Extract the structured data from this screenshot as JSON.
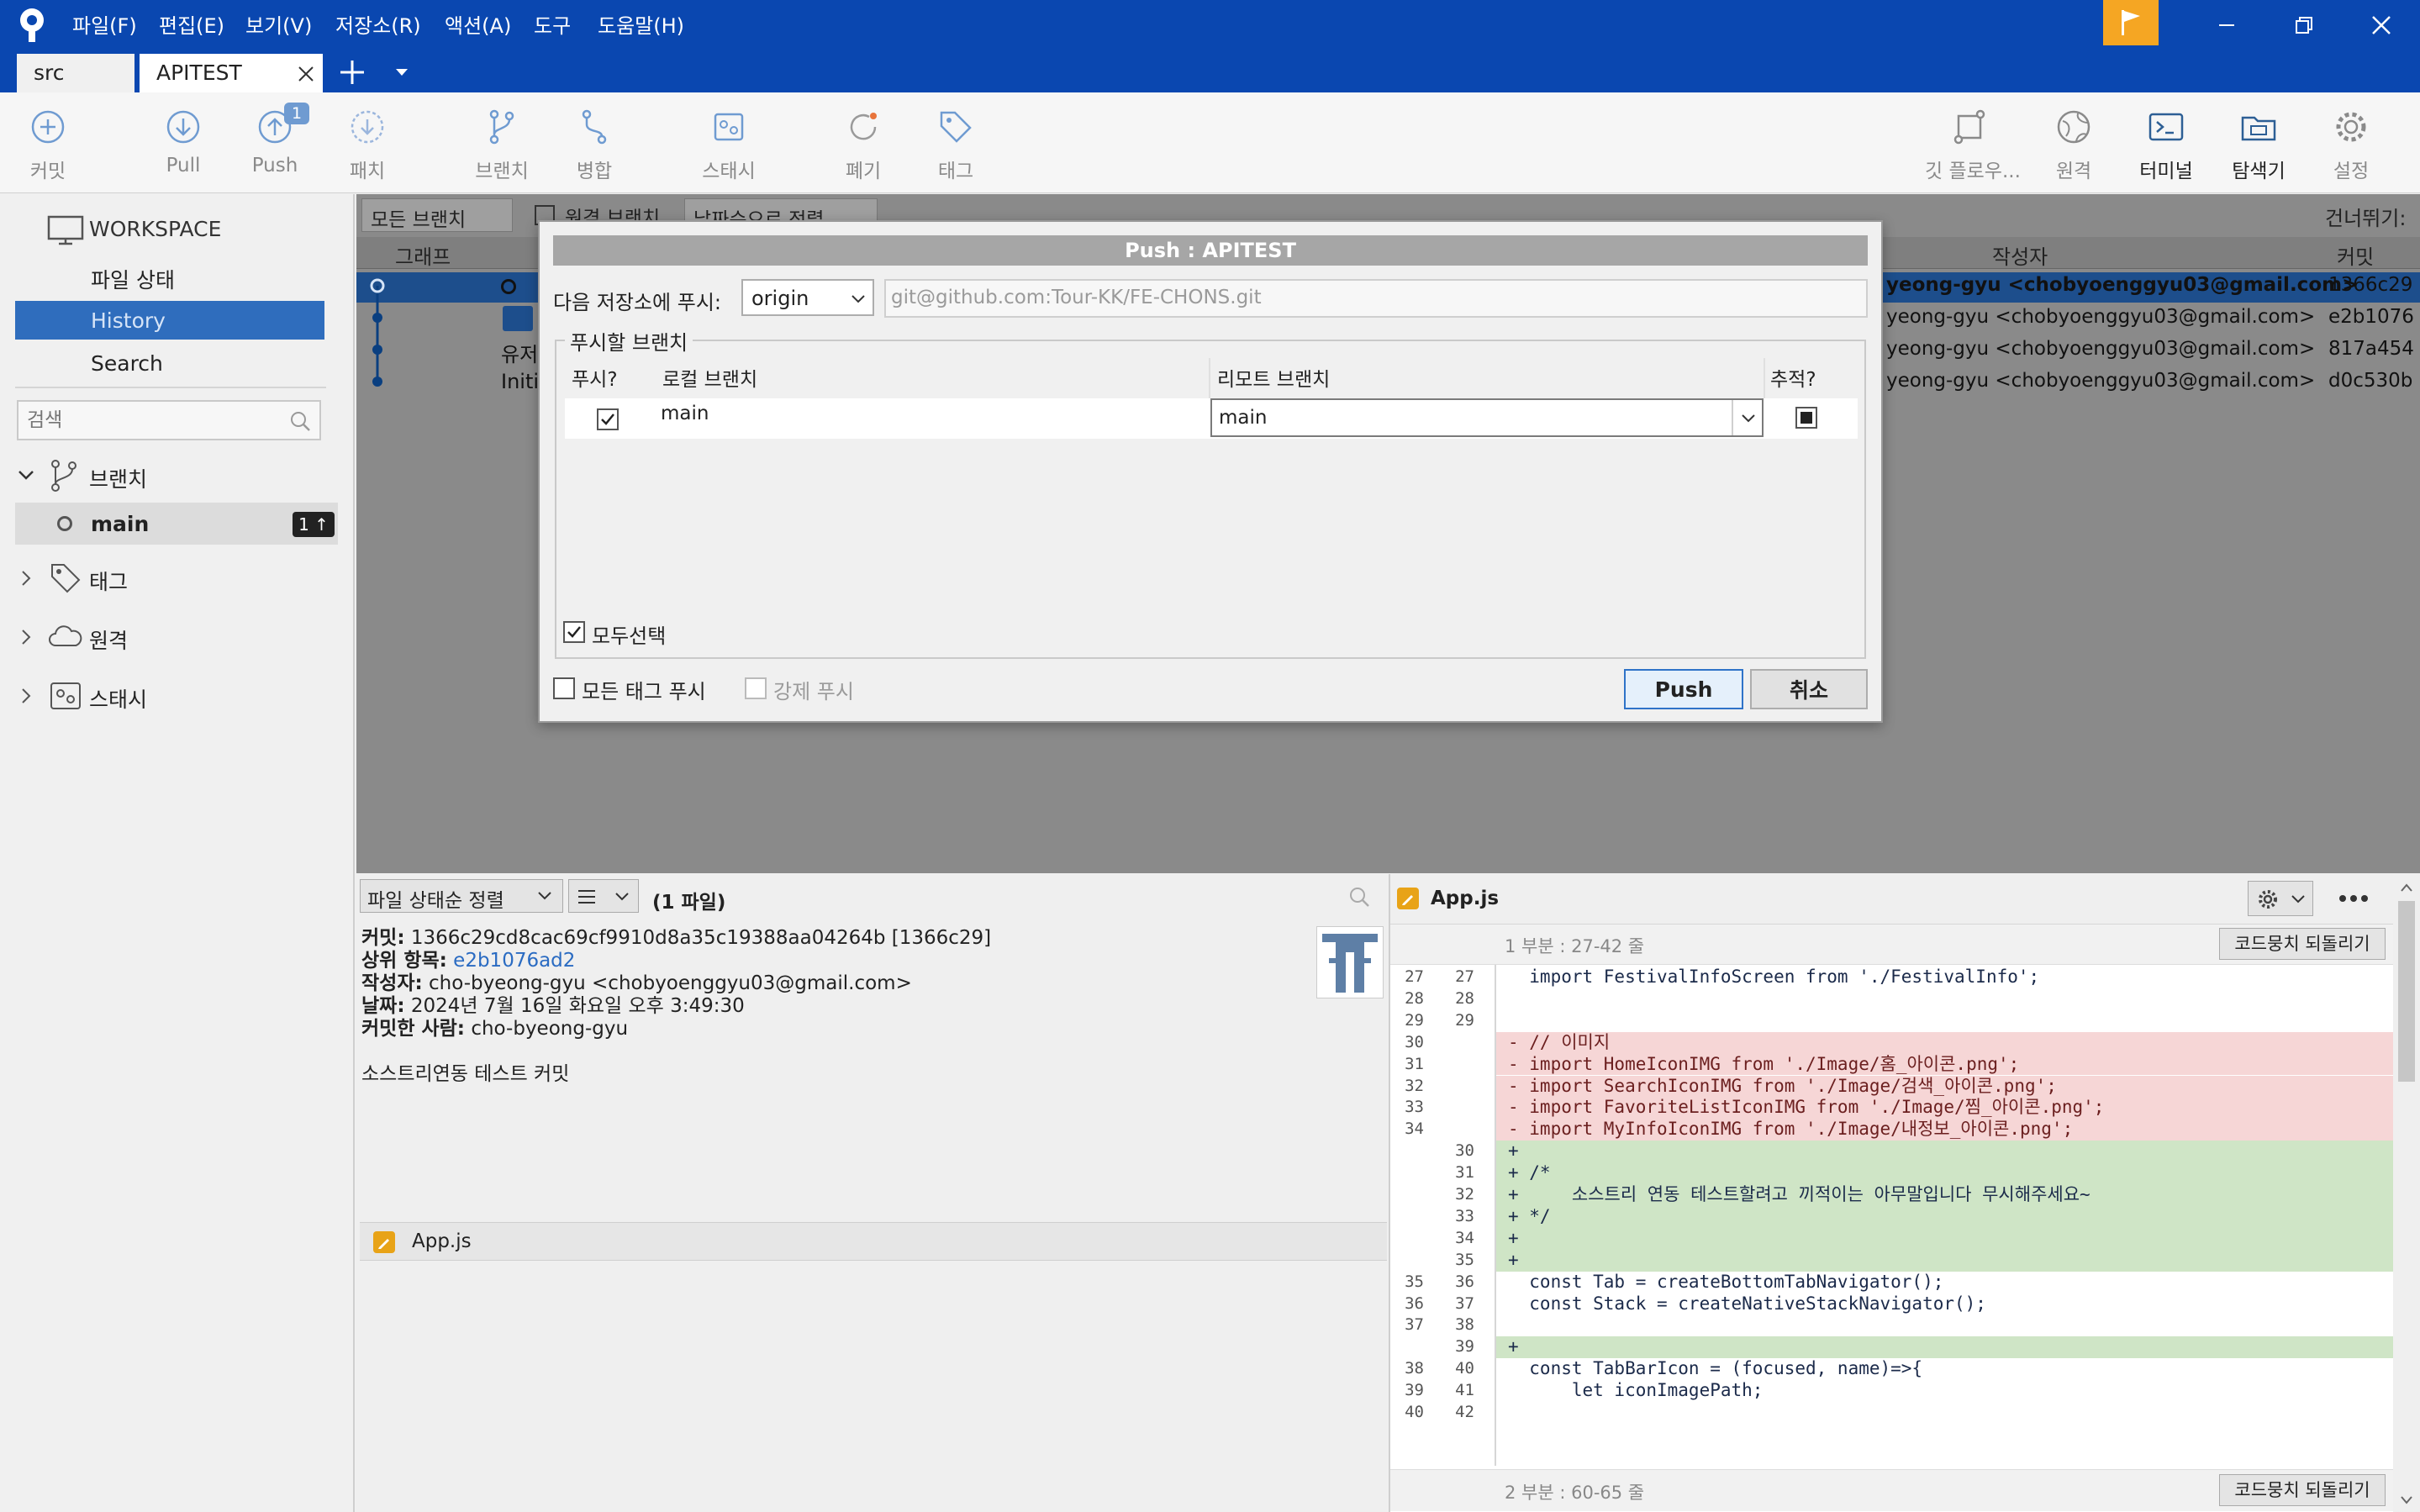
{
  "menu": [
    "파일(F)",
    "편집(E)",
    "보기(V)",
    "저장소(R)",
    "액션(A)",
    "도구",
    "도움말(H)"
  ],
  "tabs": [
    {
      "label": "src"
    },
    {
      "label": "APITEST"
    }
  ],
  "toolbar": {
    "commit": "커밋",
    "pull": "Pull",
    "push": "Push",
    "push_badge": "1",
    "patch": "패치",
    "branch": "브랜치",
    "merge": "병합",
    "stash": "스태시",
    "discard": "폐기",
    "tag": "태그",
    "gitflow": "깃 플로우...",
    "remote": "원격",
    "terminal": "터미널",
    "explorer": "탐색기",
    "settings": "설정"
  },
  "sidebar": {
    "workspace": "WORKSPACE",
    "file_status": "파일 상태",
    "history": "History",
    "search": "Search",
    "search_placeholder": "검색",
    "branches": "브랜치",
    "main_branch": "main",
    "main_badge": "1 ↑",
    "tags": "태그",
    "remotes": "원격",
    "stashes": "스태시"
  },
  "history": {
    "filter_branches": "모든 브랜치",
    "remote_branch": "원격 브랜치",
    "sort": "날짜순으로 정렬",
    "jump": "건너뛰기:",
    "col_graph": "그래프",
    "col_author": "작성자",
    "col_commit": "커밋",
    "rows": [
      {
        "desc": "",
        "author": "yeong-gyu <chobyoenggyu03@gmail.com>",
        "commit": "1366c29"
      },
      {
        "desc": "",
        "author": "yeong-gyu <chobyoenggyu03@gmail.com>",
        "commit": "e2b1076"
      },
      {
        "desc": "유저",
        "author": "yeong-gyu <chobyoenggyu03@gmail.com>",
        "commit": "817a454"
      },
      {
        "desc": "Initi",
        "author": "yeong-gyu <chobyoenggyu03@gmail.com>",
        "commit": "d0c530b"
      }
    ]
  },
  "dialog": {
    "title": "Push :  APITEST",
    "push_to_label": "다음 저장소에 푸시:",
    "remote": "origin",
    "url": "git@github.com:Tour-KK/FE-CHONS.git",
    "branches_group": "푸시할 브랜치",
    "col_push": "푸시?",
    "col_local": "로컬 브랜치",
    "col_remote": "리모트 브랜치",
    "col_track": "추적?",
    "row_local": "main",
    "row_remote": "main",
    "select_all": "모두선택",
    "push_all_tags": "모든 태그 푸시",
    "force_push": "강제 푸시",
    "push_btn": "Push",
    "cancel_btn": "취소"
  },
  "details": {
    "sort": "파일 상태순 정렬",
    "count": "(1 파일)",
    "commit_label": "커밋:",
    "commit_value": "1366c29cd8cac69cf9910d8a35c19388aa04264b [1366c29]",
    "parent_label": "상위 항목:",
    "parent_value": "e2b1076ad2",
    "author_label": "작성자:",
    "author_value": "cho-byeong-gyu <chobyoenggyu03@gmail.com>",
    "date_label": "날짜:",
    "date_value": "2024년 7월 16일 화요일 오후 3:49:30",
    "committer_label": "커밋한 사람:",
    "committer_value": "cho-byeong-gyu",
    "message": "소스트리연동 테스트 커밋",
    "file": "App.js"
  },
  "diff": {
    "file": "App.js",
    "hunk1": "1 부분 : 27-42 줄",
    "revert": "코드뭉치 되돌리기",
    "hunk2": "2 부분 : 60-65 줄",
    "lines": [
      {
        "o": "27",
        "n": "27",
        "t": "ctx",
        "c": "  import FestivalInfoScreen from './FestivalInfo';"
      },
      {
        "o": "28",
        "n": "28",
        "t": "ctx",
        "c": "  "
      },
      {
        "o": "29",
        "n": "29",
        "t": "ctx",
        "c": "  "
      },
      {
        "o": "30",
        "n": "",
        "t": "del",
        "c": "- // 이미지"
      },
      {
        "o": "31",
        "n": "",
        "t": "del",
        "c": "- import HomeIconIMG from './Image/홈_아이콘.png';"
      },
      {
        "o": "32",
        "n": "",
        "t": "del",
        "c": "- import SearchIconIMG from './Image/검색_아이콘.png';"
      },
      {
        "o": "33",
        "n": "",
        "t": "del",
        "c": "- import FavoriteListIconIMG from './Image/찜_아이콘.png';"
      },
      {
        "o": "34",
        "n": "",
        "t": "del",
        "c": "- import MyInfoIconIMG from './Image/내정보_아이콘.png';"
      },
      {
        "o": "",
        "n": "30",
        "t": "add",
        "c": "+ "
      },
      {
        "o": "",
        "n": "31",
        "t": "add",
        "c": "+ /*"
      },
      {
        "o": "",
        "n": "32",
        "t": "add",
        "c": "+     소스트리 연동 테스트할려고 끼적이는 아무말입니다 무시해주세요~"
      },
      {
        "o": "",
        "n": "33",
        "t": "add",
        "c": "+ */"
      },
      {
        "o": "",
        "n": "34",
        "t": "add",
        "c": "+ "
      },
      {
        "o": "",
        "n": "35",
        "t": "add",
        "c": "+ "
      },
      {
        "o": "35",
        "n": "36",
        "t": "ctx",
        "c": "  const Tab = createBottomTabNavigator();"
      },
      {
        "o": "36",
        "n": "37",
        "t": "ctx",
        "c": "  const Stack = createNativeStackNavigator();"
      },
      {
        "o": "37",
        "n": "38",
        "t": "ctx",
        "c": "  "
      },
      {
        "o": "",
        "n": "39",
        "t": "add",
        "c": "+ "
      },
      {
        "o": "38",
        "n": "40",
        "t": "ctx",
        "c": "  const TabBarIcon = (focused, name)=>{"
      },
      {
        "o": "39",
        "n": "41",
        "t": "ctx",
        "c": "      let iconImagePath;"
      },
      {
        "o": "40",
        "n": "42",
        "t": "ctx",
        "c": "  "
      }
    ]
  }
}
